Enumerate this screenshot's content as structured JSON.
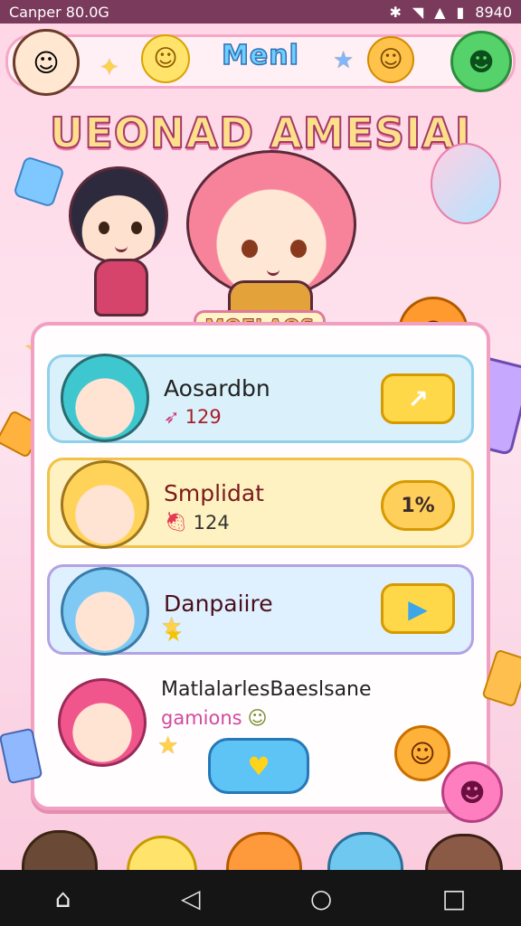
{
  "status_bar": {
    "left_text": "Canper 80.0G",
    "right_text": "8940"
  },
  "header": {
    "title": "Menl"
  },
  "banner": {
    "title": "UEONAD AMESIAI",
    "subtitle": "MOELAOS"
  },
  "list": {
    "items": [
      {
        "name": "Aosardbn",
        "meta_value": "129",
        "meta_icon": "arrow-icon",
        "button_icon": "arrow-right-icon",
        "button_label": "↗"
      },
      {
        "name": "Smplidat",
        "meta_value": "124",
        "meta_icon": "strawberry-icon",
        "button_icon": "cloud-badge-icon",
        "button_label": "1%"
      },
      {
        "name": "Danpaiire",
        "meta_value": "",
        "meta_icon": "star-icon",
        "button_icon": "play-icon",
        "button_label": "▶"
      },
      {
        "name": "MatlalarlesBaeslsane",
        "meta_value": "gamions",
        "meta_icon": "smile-icon",
        "button_icon": "heart-icon",
        "button_label": "♥"
      }
    ]
  },
  "nav": {
    "home": "⌂",
    "back": "◁",
    "circle": "○",
    "square": "□"
  },
  "colors": {
    "accent_pink": "#f2a0c2",
    "button_yellow": "#ffd84a",
    "button_blue": "#5ec3f5",
    "row_blue": "#d9f2ff",
    "row_yellow": "#fff2c2"
  }
}
